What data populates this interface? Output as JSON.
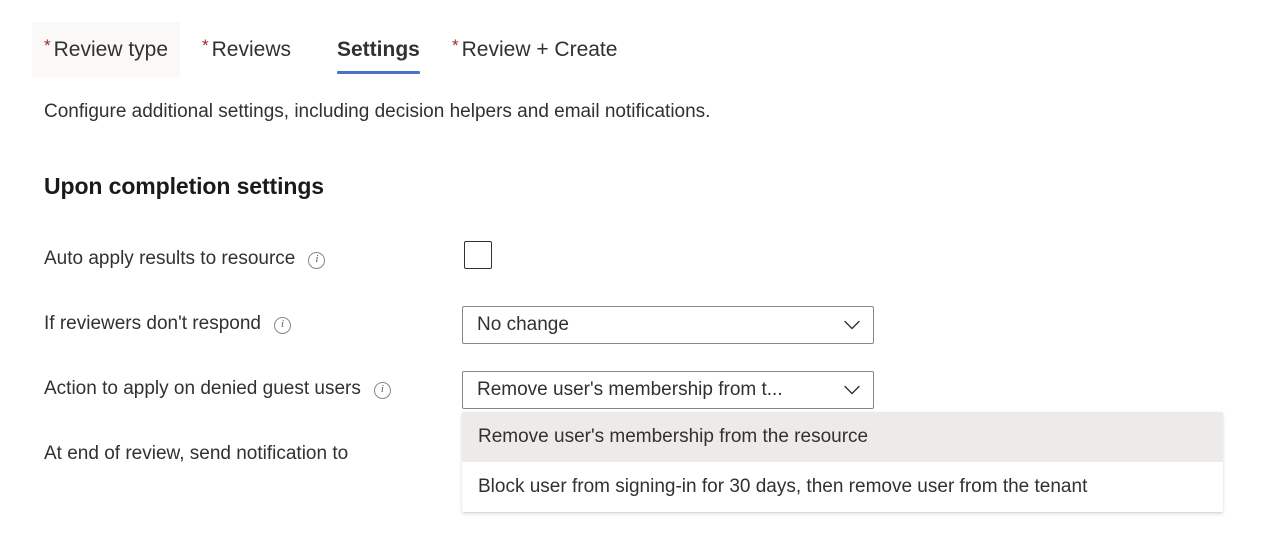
{
  "tabs": [
    {
      "label": "Review type",
      "required": true,
      "active": false,
      "hovered": true,
      "required_mark": "*"
    },
    {
      "label": "Reviews",
      "required": true,
      "active": false,
      "hovered": false,
      "required_mark": "*"
    },
    {
      "label": "Settings",
      "required": false,
      "active": true,
      "hovered": false,
      "required_mark": ""
    },
    {
      "label": "Review + Create",
      "required": true,
      "active": false,
      "hovered": false,
      "required_mark": "*"
    }
  ],
  "intro": {
    "text": "Configure additional settings, including decision helpers and email notifications."
  },
  "section": {
    "heading": "Upon completion settings"
  },
  "rows": {
    "auto_apply": {
      "label": "Auto apply results to resource",
      "info_icon": "info-icon",
      "checkbox_checked": false
    },
    "no_respond": {
      "label": "If reviewers don't respond",
      "info_icon": "info-icon",
      "selected_value": "No change",
      "chevron_icon": "chevron-down-icon"
    },
    "denied_guest": {
      "label": "Action to apply on denied guest users",
      "info_icon": "info-icon",
      "selected_value": "Remove user's membership from t...",
      "chevron_icon": "chevron-down-icon",
      "options": [
        {
          "label": "Remove user's membership from the resource",
          "selected": true
        },
        {
          "label": "Block user from signing-in for 30 days, then remove user from the tenant",
          "selected": false
        }
      ]
    },
    "notify": {
      "label": "At end of review, send notification to"
    }
  },
  "colors": {
    "required_asterisk": "#a4262c",
    "active_tab_underline": "#4a72c4",
    "option_selected_bg": "#edebe9",
    "tab_hover_bg": "#faf9f8",
    "text_primary": "#323130",
    "border": "#8a8886"
  }
}
